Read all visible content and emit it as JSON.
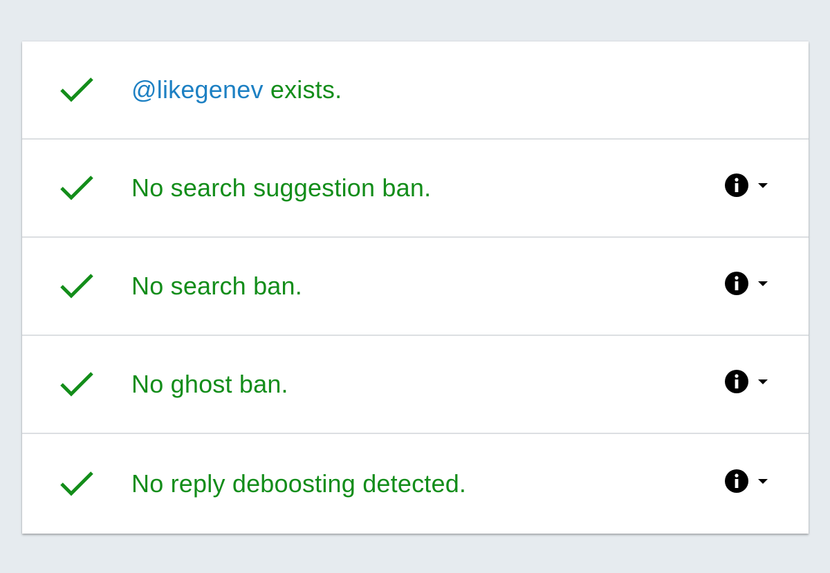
{
  "colors": {
    "success": "#138d1a",
    "link": "#1d80c3",
    "background": "#e6ebef",
    "card": "#ffffff",
    "icon": "#000000"
  },
  "checks": [
    {
      "status_icon": "checkmark-icon",
      "handle": "@likegenev",
      "text": "exists.",
      "has_actions": false
    },
    {
      "status_icon": "checkmark-icon",
      "text": "No search suggestion ban.",
      "has_actions": true,
      "info_icon": "info-icon",
      "expand_icon": "caret-down-icon"
    },
    {
      "status_icon": "checkmark-icon",
      "text": "No search ban.",
      "has_actions": true,
      "info_icon": "info-icon",
      "expand_icon": "caret-down-icon"
    },
    {
      "status_icon": "checkmark-icon",
      "text": "No ghost ban.",
      "has_actions": true,
      "info_icon": "info-icon",
      "expand_icon": "caret-down-icon"
    },
    {
      "status_icon": "checkmark-icon",
      "text": "No reply deboosting detected.",
      "has_actions": true,
      "info_icon": "info-icon",
      "expand_icon": "caret-down-icon"
    }
  ]
}
